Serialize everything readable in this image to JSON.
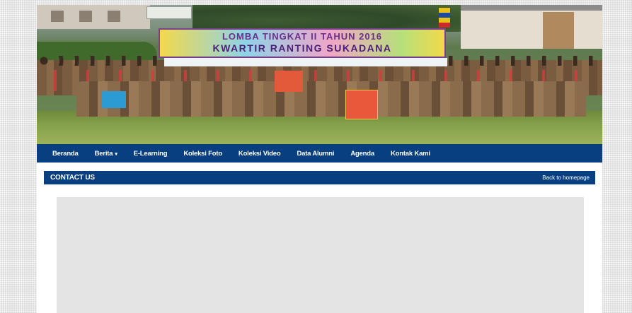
{
  "banner": {
    "line1": "LOMBA TINGKAT II TAHUN 2016",
    "line2": "KWARTIR RANTING SUKADANA"
  },
  "nav": {
    "items": [
      {
        "label": "Beranda"
      },
      {
        "label": "Berita",
        "caret": "▾"
      },
      {
        "label": "E-Learning"
      },
      {
        "label": "Koleksi Foto"
      },
      {
        "label": "Koleksi Video"
      },
      {
        "label": "Data Alumni"
      },
      {
        "label": "Agenda"
      },
      {
        "label": "Kontak Kami"
      }
    ]
  },
  "section": {
    "title": "CONTACT US",
    "back_link": "Back to homepage"
  },
  "colors": {
    "nav_bg": "#073f80",
    "page_bg": "#ffffff",
    "map_placeholder": "#e4e4e4"
  }
}
